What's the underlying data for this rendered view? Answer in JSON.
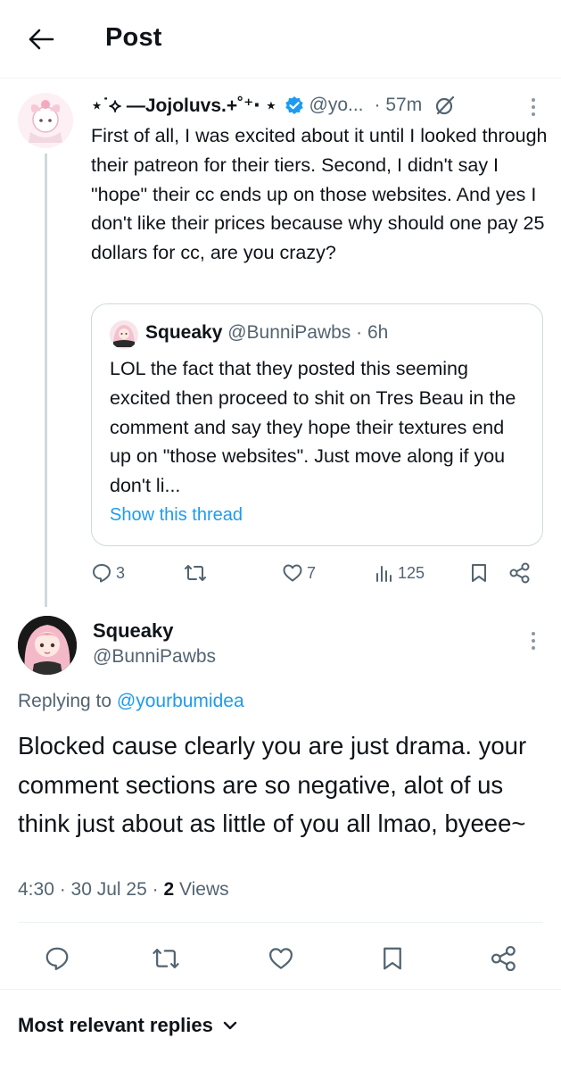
{
  "header": {
    "title": "Post"
  },
  "parent_post": {
    "display_name": "⋆˙⟡ —Jojoluvs.+˚⁺‧ ⋆",
    "handle": "@yo...",
    "time": "· 57m",
    "body": "First of all, I was excited about it until I looked through their patreon for their tiers. Second, I didn't say I \"hope\" their cc ends up on those websites. And yes I don't like their prices because why should one pay 25 dollars for cc, are you crazy?",
    "quote": {
      "display_name": "Squeaky",
      "meta": "@BunniPawbs · 6h",
      "body": "LOL the fact that they posted this seeming excited then proceed to shit on Tres Beau in the comment and say they hope their textures end up on \"those websites\". Just move along if you don't li...",
      "link": "Show this thread"
    },
    "stats": {
      "replies": "3",
      "reposts": "",
      "likes": "7",
      "views": "125"
    }
  },
  "main_post": {
    "display_name": "Squeaky",
    "handle": "@BunniPawbs",
    "replying_prefix": "Replying to",
    "replying_to": "@yourbumidea",
    "body": "Blocked cause clearly you are just drama. your comment sections are so negative, alot of us think just about as little of you all lmao, byeee~",
    "time": "4:30 · 30 Jul 25 ·",
    "views_count": "2",
    "views_label": "Views"
  },
  "replies_sort": {
    "label": "Most relevant replies"
  },
  "colors": {
    "accent": "#1d9bf0",
    "secondary_text": "#536471",
    "border": "#cfd9de"
  }
}
